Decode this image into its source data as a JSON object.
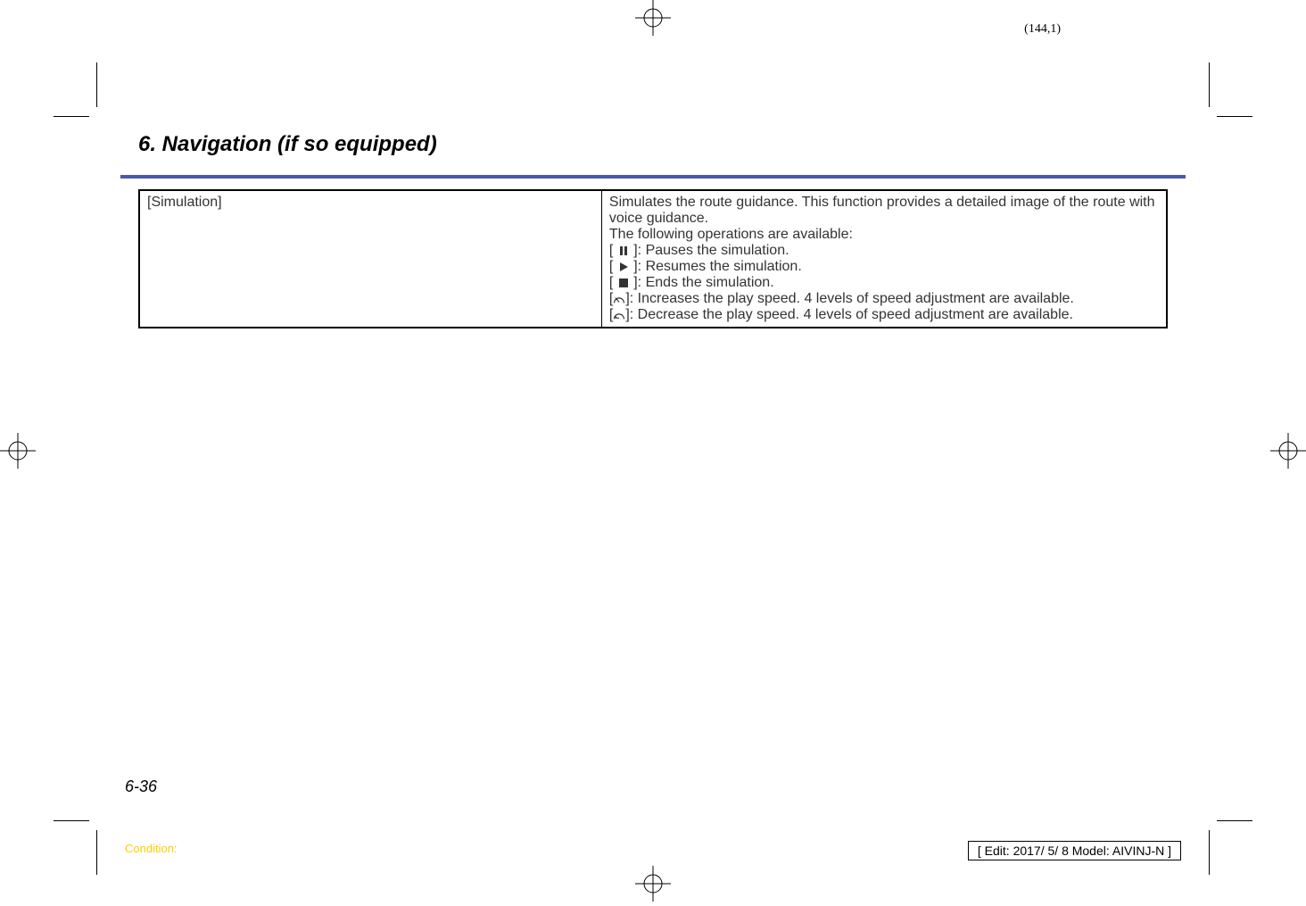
{
  "page_coords": "(144,1)",
  "section_title": "6. Navigation (if so equipped)",
  "table": {
    "row": {
      "label": "[Simulation]",
      "desc_line1": "Simulates the route guidance. This function provides a detailed image of the route with voice guidance.",
      "desc_line2": "The following operations are available:",
      "op_pause": "]: Pauses the simulation.",
      "op_resume": "]: Resumes the simulation.",
      "op_end": "]: Ends the simulation.",
      "op_increase": "]: Increases the play speed. 4 levels of speed adjustment are available.",
      "op_decrease": "]: Decrease the play speed. 4 levels of speed adjustment are available."
    }
  },
  "page_number": "6-36",
  "condition_label": "Condition:",
  "edit_info": "[ Edit: 2017/ 5/ 8    Model:  AIVINJ-N ]"
}
